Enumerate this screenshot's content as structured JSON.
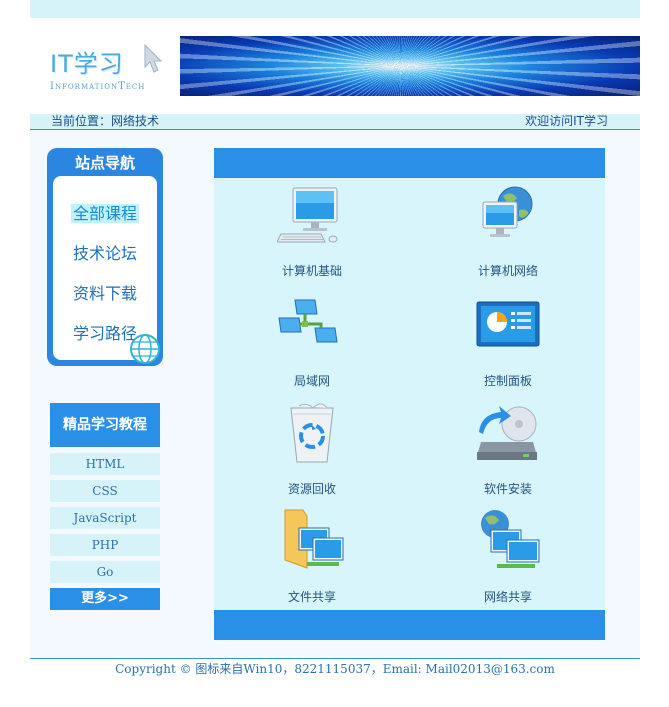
{
  "header": {
    "logo_main": "IT学习",
    "logo_sub": "InformationTech"
  },
  "location_bar": {
    "current": "当前位置：网络技术",
    "welcome": "欢迎访问IT学习"
  },
  "site_nav": {
    "title": "站点导航",
    "items": [
      {
        "label": "全部课程",
        "active": true
      },
      {
        "label": "技术论坛",
        "active": false
      },
      {
        "label": "资料下载",
        "active": false
      },
      {
        "label": "学习路径",
        "active": false
      }
    ]
  },
  "tutorials": {
    "title": "精品学习教程",
    "items": [
      "HTML",
      "CSS",
      "JavaScript",
      "PHP",
      "Go"
    ],
    "more": "更多>>"
  },
  "main": {
    "tiles": [
      {
        "label": "计算机基础",
        "icon": "computer-icon"
      },
      {
        "label": "计算机网络",
        "icon": "network-globe-icon"
      },
      {
        "label": "局域网",
        "icon": "lan-icon"
      },
      {
        "label": "控制面板",
        "icon": "control-panel-icon"
      },
      {
        "label": "资源回收",
        "icon": "recycle-bin-icon"
      },
      {
        "label": "软件安装",
        "icon": "software-install-icon"
      },
      {
        "label": "文件共享",
        "icon": "file-share-icon"
      },
      {
        "label": "网络共享",
        "icon": "network-share-icon"
      }
    ]
  },
  "footer": {
    "text": "Copyright © 图标来自Win10，8221115037，Email: Mail02013@163.com"
  },
  "colors": {
    "accent": "#2a8fe6",
    "light_panel": "#d7f5fb",
    "text": "#2a6fb0"
  }
}
